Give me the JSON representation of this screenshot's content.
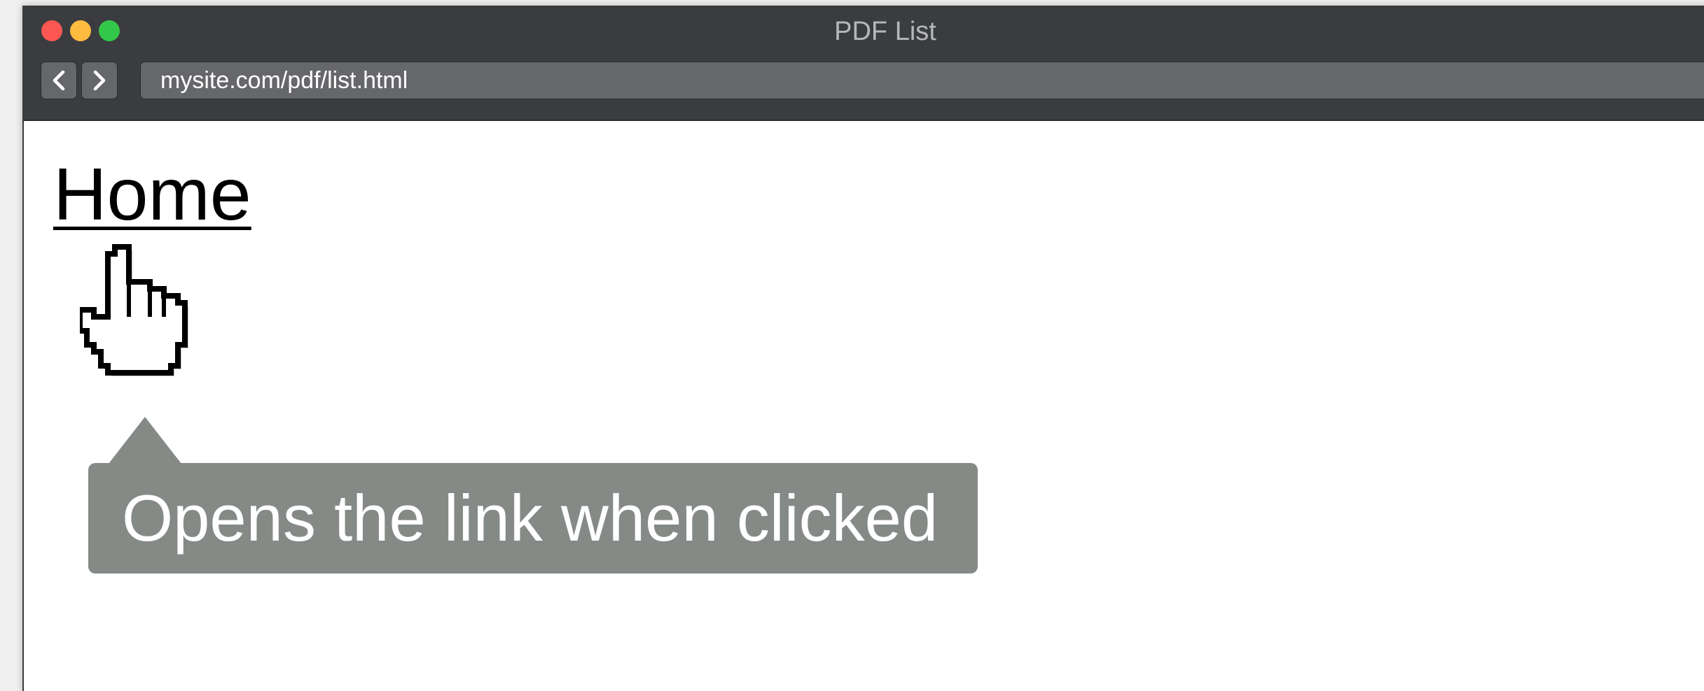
{
  "window": {
    "title": "PDF List"
  },
  "browser": {
    "url": "mysite.com/pdf/list.html",
    "back_icon": "chevron-left-icon",
    "forward_icon": "chevron-right-icon"
  },
  "page": {
    "home_link": "Home"
  },
  "cursor": {
    "icon": "pointing-hand-cursor-icon"
  },
  "tooltip": {
    "text": "Opens the link when clicked"
  },
  "colors": {
    "titlebar": "#3b3c3f",
    "close": "#fc5753",
    "minimize": "#fdbc40",
    "maximize": "#34c84a",
    "tooltip_bg": "#858a87"
  }
}
